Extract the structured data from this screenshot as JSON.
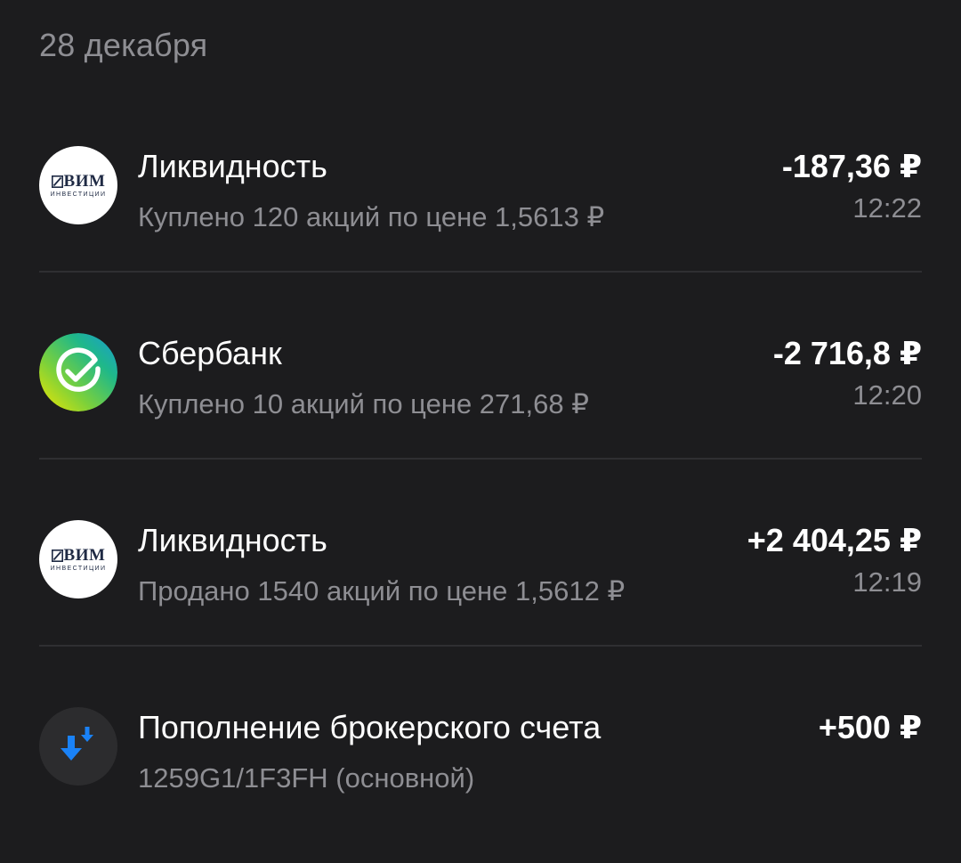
{
  "date_header": "28 декабря",
  "operations": [
    {
      "icon": "vim-investments-logo-icon",
      "logo_main": "ВИМ",
      "logo_sub": "ИНВЕСТИЦИИ",
      "title": "Ликвидность",
      "subtitle": "Куплено 120 акций по цене 1,5613 ₽",
      "amount": "-187,36 ₽",
      "time": "12:22"
    },
    {
      "icon": "sberbank-logo-icon",
      "title": "Сбербанк",
      "subtitle": "Куплено 10 акций по цене 271,68 ₽",
      "amount": "-2 716,8 ₽",
      "time": "12:20"
    },
    {
      "icon": "vim-investments-logo-icon",
      "logo_main": "ВИМ",
      "logo_sub": "ИНВЕСТИЦИИ",
      "title": "Ликвидность",
      "subtitle": "Продано 1540 акций по цене 1,5612 ₽",
      "amount": "+2 404,25 ₽",
      "time": "12:19"
    },
    {
      "icon": "deposit-arrows-icon",
      "title": "Пополнение брокерского счета",
      "subtitle": "1259G1/1F3FH (основной)",
      "amount": "+500 ₽"
    }
  ],
  "colors": {
    "background": "#1c1c1e",
    "secondary_text": "#8e8e93",
    "divider": "#2f2f32",
    "deposit_arrow": "#1a82f7"
  }
}
